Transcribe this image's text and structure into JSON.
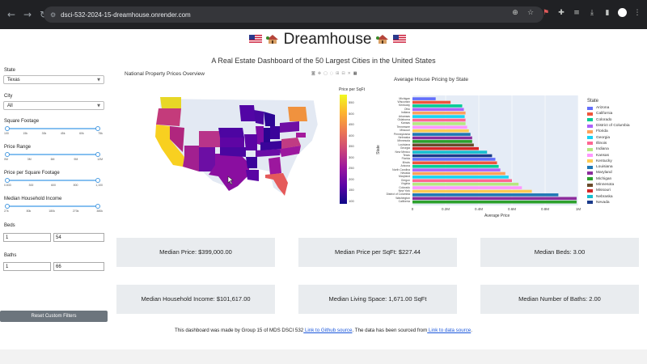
{
  "browser": {
    "url": "dsci-532-2024-15-dreamhouse.onrender.com",
    "icons": [
      "back-arrow-icon",
      "forward-arrow-icon",
      "reload-icon",
      "site-info-icon",
      "zoom-icon",
      "bookmark-star-icon",
      "extensions-icon",
      "downloads-icon",
      "profile-icon",
      "menu-icon"
    ]
  },
  "header": {
    "title": "Dreamhouse",
    "subtitle": "A Real Estate Dashboard of the 50 Largest Cities in the United States"
  },
  "sidebar": {
    "state_label": "State",
    "state_value": "Texas",
    "city_label": "City",
    "city_value": "All",
    "sqft_label": "Square Footage",
    "sqft_ticks": [
      "100",
      "15k",
      "30k",
      "45k",
      "60k",
      "75k"
    ],
    "price_label": "Price Range",
    "price_ticks": [
      "0M",
      "3M",
      "6M",
      "9M",
      "12M"
    ],
    "ppsf_label": "Price per Square Footage",
    "ppsf_ticks": [
      "0.833",
      "300",
      "600",
      "800",
      "1,100"
    ],
    "income_label": "Median Household Income",
    "income_ticks": [
      "27k",
      "80k",
      "180k",
      "270k",
      "380k"
    ],
    "beds_label": "Beds",
    "beds_min": "1",
    "beds_max": "54",
    "baths_label": "Baths",
    "baths_min": "1",
    "baths_max": "66",
    "reset_label": "Reset Custom Filters"
  },
  "map": {
    "title": "National Property Prices Overview",
    "colorbar_title": "Price per SqFt",
    "colorbar_ticks": [
      "550",
      "500",
      "450",
      "400",
      "350",
      "300",
      "250",
      "200",
      "150",
      "100"
    ],
    "toolbar_icons": [
      "camera-icon",
      "pan-icon",
      "box-select-icon",
      "lasso-icon",
      "zoom-in-icon",
      "zoom-out-icon",
      "reset-icon",
      "plotly-logo-icon"
    ]
  },
  "chart_data": {
    "type": "bar",
    "title": "Average House Pricing by State",
    "xlabel": "Average Price",
    "ylabel": "State",
    "xlim": [
      0,
      1000000
    ],
    "x_ticks": [
      "0",
      "0.2M",
      "0.4M",
      "0.6M",
      "0.8M",
      "1M"
    ],
    "legend_title": "State",
    "legend_position": "right",
    "categories": [
      "Michigan",
      "Wisconsin",
      "Kentucky",
      "Ohio",
      "Indiana",
      "Arkansas",
      "Oklahoma",
      "Kansas",
      "Tennessee",
      "Missouri",
      "Pennsylvania",
      "Nebraska",
      "Minnesota",
      "Louisiana",
      "Georgia",
      "New Mexico",
      "Texas",
      "Florida",
      "Illinois",
      "Arizona",
      "North Carolina",
      "Nevada",
      "Maryland",
      "Oregon",
      "Virginia",
      "Colorado",
      "New York",
      "District of Columbia",
      "Washington",
      "California"
    ],
    "values": [
      140000,
      230000,
      300000,
      310000,
      320000,
      315000,
      320000,
      320000,
      330000,
      340000,
      350000,
      360000,
      360000,
      370000,
      400000,
      450000,
      480000,
      500000,
      510000,
      520000,
      530000,
      560000,
      580000,
      600000,
      640000,
      660000,
      720000,
      880000,
      990000,
      990000
    ],
    "legend_entries": [
      {
        "name": "Arizona",
        "color": "#636efa"
      },
      {
        "name": "California",
        "color": "#ef553b"
      },
      {
        "name": "Colorado",
        "color": "#00cc96"
      },
      {
        "name": "District of Columbia",
        "color": "#ab63fa"
      },
      {
        "name": "Florida",
        "color": "#ffa15a"
      },
      {
        "name": "Georgia",
        "color": "#19d3f3"
      },
      {
        "name": "Illinois",
        "color": "#ff6692"
      },
      {
        "name": "Indiana",
        "color": "#b6e880"
      },
      {
        "name": "Kansas",
        "color": "#ff97ff"
      },
      {
        "name": "Kentucky",
        "color": "#fecb52"
      },
      {
        "name": "Louisiana",
        "color": "#1f77b4"
      },
      {
        "name": "Maryland",
        "color": "#8c2d9c"
      },
      {
        "name": "Michigan",
        "color": "#2ca02c"
      },
      {
        "name": "Minnesota",
        "color": "#6a4b2a"
      },
      {
        "name": "Missouri",
        "color": "#d62728"
      },
      {
        "name": "Nebraska",
        "color": "#17becf"
      },
      {
        "name": "Nevada",
        "color": "#1a3a8a"
      }
    ]
  },
  "cards": [
    {
      "label": "Median Price: $399,000.00"
    },
    {
      "label": "Median Price per SqFt: $227.44"
    },
    {
      "label": "Median Beds: 3.00"
    },
    {
      "label": "Median Household Income: $101,617.00"
    },
    {
      "label": "Median Living Space: 1,671.00 SqFt"
    },
    {
      "label": "Median Number of Baths: 2.00"
    }
  ],
  "footer": {
    "text_1": "This dashboard was made by Group 15 of MDS DSCI 532",
    "link_1": " Link to Github source",
    "text_2": ". The data has been sourced from",
    "link_2": " Link to data source",
    "text_3": "."
  }
}
